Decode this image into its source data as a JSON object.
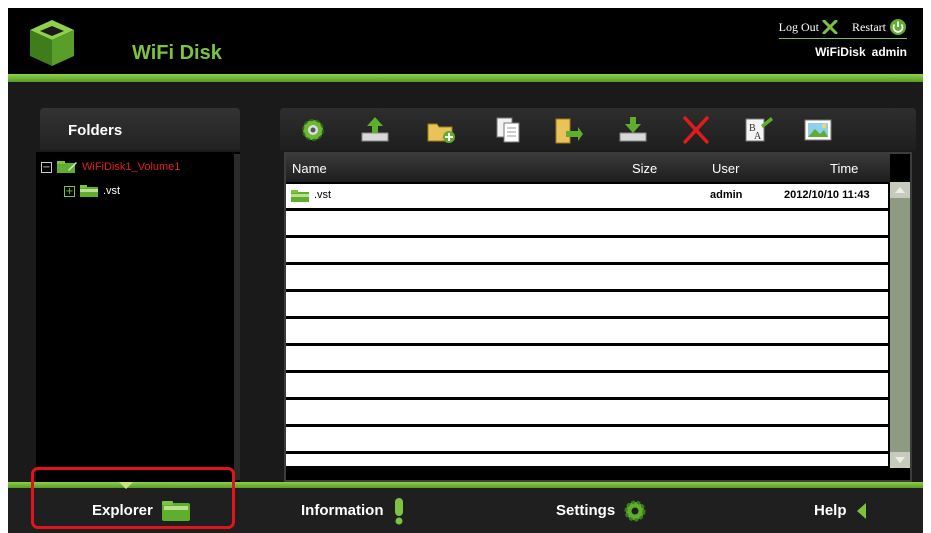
{
  "header": {
    "app_title": "WiFi Disk",
    "logout_label": "Log Out",
    "restart_label": "Restart",
    "device_name": "WiFiDisk",
    "user": "admin"
  },
  "folders": {
    "title": "Folders",
    "tree": [
      {
        "label": "WiFiDisk1_Volume1",
        "toggle": "−",
        "color": "#e02020"
      },
      {
        "label": ".vst",
        "toggle": "+",
        "color": "#ffffff"
      }
    ]
  },
  "toolbar": {
    "icons": [
      "settings-gear-icon",
      "upload-icon",
      "new-folder-icon",
      "copy-icon",
      "move-icon",
      "download-icon",
      "delete-icon",
      "rename-icon",
      "thumbnail-icon"
    ]
  },
  "file_table": {
    "columns": [
      "Name",
      "Size",
      "User",
      "Time"
    ],
    "rows": [
      {
        "name": ".vst",
        "size": "",
        "user": "admin",
        "time": "2012/10/10 11:43"
      }
    ]
  },
  "bottom_nav": {
    "explorer": "Explorer",
    "information": "Information",
    "settings": "Settings",
    "help": "Help",
    "active": "Explorer"
  },
  "colors": {
    "accent_green": "#7dc241",
    "highlight_red": "#e0141b"
  }
}
